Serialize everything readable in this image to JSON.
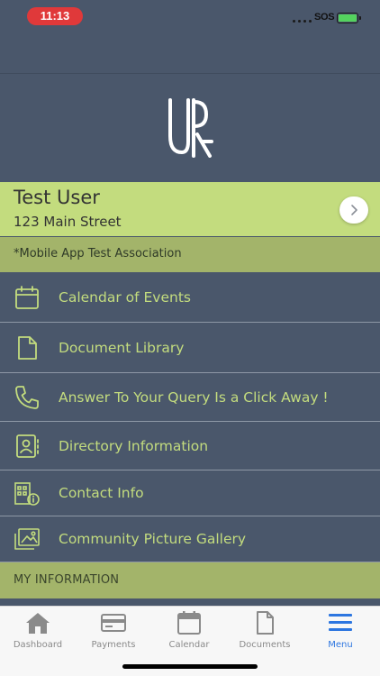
{
  "status_bar": {
    "time": "11:13",
    "carrier": "SOS"
  },
  "profile": {
    "name": "Test User",
    "address": "123 Main Street"
  },
  "association": "*Mobile App Test Association",
  "menu": [
    {
      "label": "Calendar of Events",
      "icon": "calendar-icon"
    },
    {
      "label": "Document Library",
      "icon": "document-icon"
    },
    {
      "label": "Answer To Your Query Is a Click Away !",
      "icon": "phone-icon"
    },
    {
      "label": "Directory Information",
      "icon": "contact-card-icon"
    },
    {
      "label": "Contact Info",
      "icon": "building-info-icon"
    },
    {
      "label": "Community Picture Gallery",
      "icon": "picture-icon"
    }
  ],
  "section_header": "MY INFORMATION",
  "tabs": [
    {
      "label": "Dashboard",
      "icon": "home-icon"
    },
    {
      "label": "Payments",
      "icon": "credit-card-icon"
    },
    {
      "label": "Calendar",
      "icon": "calendar-icon"
    },
    {
      "label": "Documents",
      "icon": "document-icon"
    },
    {
      "label": "Menu",
      "icon": "hamburger-menu-icon",
      "active": true
    }
  ],
  "colors": {
    "background": "#4a576b",
    "accent_green": "#c3dc7e",
    "section_green": "#a3b46a",
    "active_tab": "#2d76e0",
    "time_pill": "#e0393a"
  }
}
